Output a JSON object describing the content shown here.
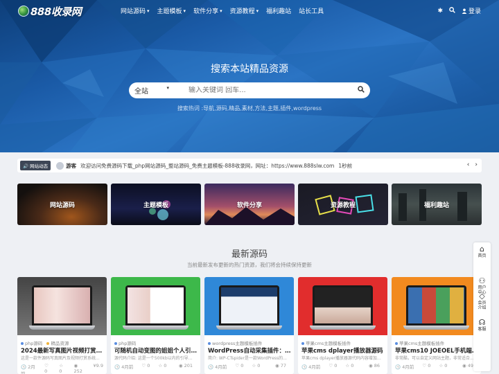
{
  "brand": {
    "logo_text": "888收录网"
  },
  "nav": {
    "items": [
      {
        "label": "网站源码",
        "caret": "▾"
      },
      {
        "label": "主题模板",
        "caret": "▾"
      },
      {
        "label": "软件分享",
        "caret": "▾"
      },
      {
        "label": "资源教程",
        "caret": "▾"
      },
      {
        "label": "福利趣站",
        "caret": ""
      },
      {
        "label": "站长工具",
        "caret": ""
      }
    ],
    "login_label": "登录"
  },
  "hero": {
    "title": "搜索本站精品资源",
    "search_scope": "全站",
    "search_placeholder": "输入关键词 回车...",
    "hotwords": "搜索热词 :导航,源码,精品,素材,方法,主题,插件,wordpress"
  },
  "notice": {
    "tag": "网站动态",
    "who": "游客",
    "message": "欢迎访问免费源码下载_php网站源码_整站源码_免费主题模板-888收录网，网址：https://www.888slw.com",
    "time": "1秒前"
  },
  "categories": [
    {
      "label": "网站源码"
    },
    {
      "label": "主题模板"
    },
    {
      "label": "软件分享"
    },
    {
      "label": "资源教程"
    },
    {
      "label": "福利趣站"
    }
  ],
  "section": {
    "title": "最新源码",
    "subtitle": "当前最新发布更新的热门资源，我们将会持续保持更新"
  },
  "cards": [
    {
      "meta1": "php源码",
      "meta2": "精品资源",
      "title": "2024最新写真图片视频打赏系...",
      "desc": "这是一款件源码写真图片及视频打赏系统...",
      "time": "2月前",
      "likes": "0",
      "favs": "0",
      "views": "252",
      "price": "¥9.9"
    },
    {
      "meta1": "php源码",
      "meta2": "",
      "title": "可随机自动变图的姐姐个人引导...",
      "desc": "源代码介绍: 这是一个500kb以内的引导...",
      "time": "4月前",
      "likes": "0",
      "favs": "0",
      "views": "201",
      "price": ""
    },
    {
      "meta1": "wordpress主题模板插件",
      "meta2": "",
      "title": "WordPress自动采集插件：W...",
      "desc": "简介: WP-CTspider是一款WordPress的...",
      "time": "4月前",
      "likes": "0",
      "favs": "0",
      "views": "77",
      "price": ""
    },
    {
      "meta1": "苹果cms主题模板插件",
      "meta2": "",
      "title": "苹果cms dplayer播放器源码",
      "desc": "苹果cms dplayer播放器源代码内容增加功...",
      "time": "4月前",
      "likes": "0",
      "favs": "0",
      "views": "86",
      "price": ""
    },
    {
      "meta1": "苹果cms主题模板插件",
      "meta2": "",
      "title": "苹果cms10 JOEOEL手机端模板",
      "desc": "非常酷，可以自定义网站主题，非常适合...",
      "time": "4月前",
      "likes": "0",
      "favs": "0",
      "views": "49",
      "price": ""
    }
  ],
  "sidebar": [
    {
      "icon": "home-icon",
      "label1": "首页",
      "label2": ""
    },
    {
      "icon": "user-icon",
      "label1": "用户",
      "label2": "中心"
    },
    {
      "icon": "diamond-icon",
      "label1": "会员",
      "label2": "介绍"
    },
    {
      "icon": "support-icon",
      "label1": "客服",
      "label2": ""
    }
  ]
}
